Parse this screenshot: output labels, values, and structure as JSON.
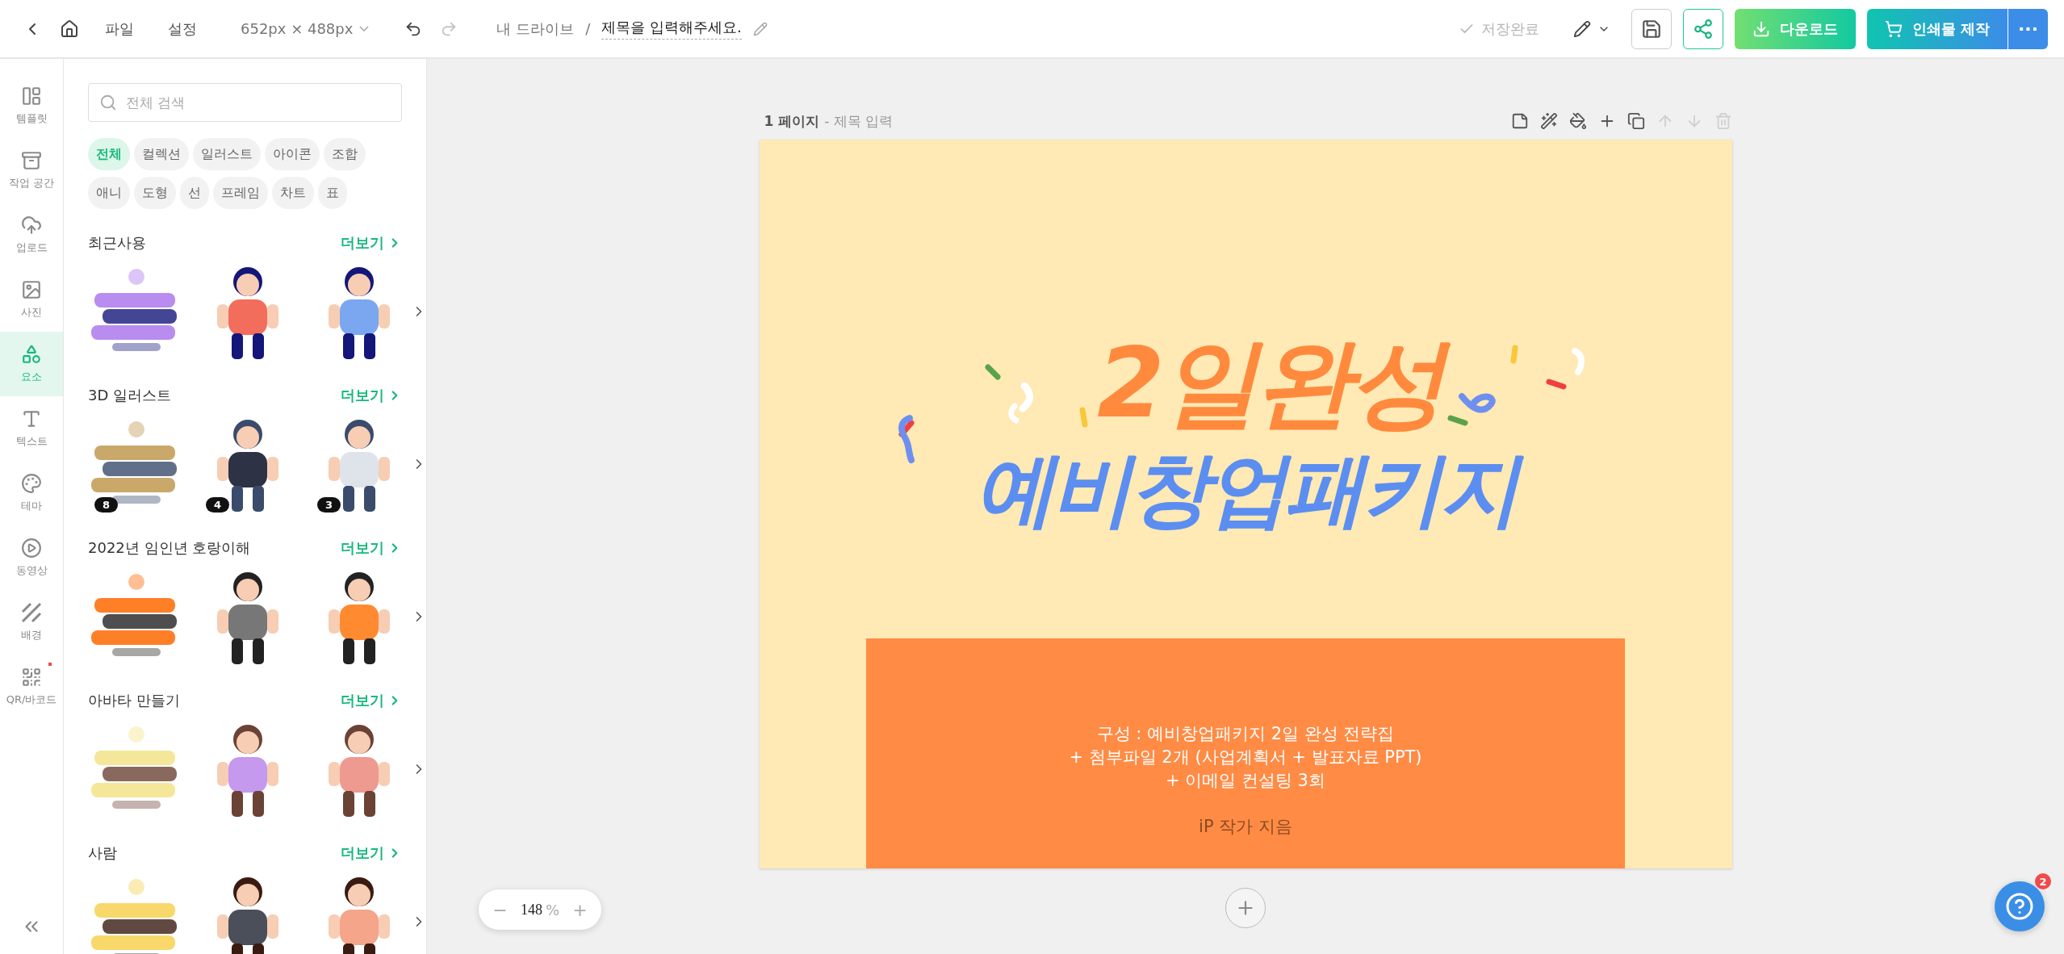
{
  "topbar": {
    "menu": [
      "파일",
      "설정"
    ],
    "size": "652px × 488px",
    "undo_disabled": false,
    "redo_disabled": true,
    "breadcrumb": "내 드라이브",
    "separator": "/",
    "title": "제목을 입력해주세요.",
    "save_status": "저장완료",
    "download": "다운로드",
    "print": "인쇄물 제작",
    "more": "···"
  },
  "rail": [
    {
      "kind": "template",
      "label": "템플릿",
      "selected": false
    },
    {
      "kind": "workspace",
      "label": "작업 공간",
      "selected": false
    },
    {
      "kind": "upload",
      "label": "업로드",
      "selected": false
    },
    {
      "label": "사진",
      "selected": false
    },
    {
      "kind": "elements",
      "label": "요소",
      "selected": true
    },
    {
      "kind": "text",
      "label": "텍스트",
      "selected": false
    },
    {
      "kind": "theme",
      "label": "테마",
      "selected": false
    },
    {
      "kind": "video",
      "label": "동영상",
      "selected": false
    },
    {
      "kind": "background",
      "label": "배경",
      "selected": false
    },
    {
      "kind": "qr",
      "label": "QR/바코드",
      "selected": false,
      "dot": true
    }
  ],
  "panel": {
    "search": {
      "placeholder": "전체 검색"
    },
    "chips": [
      {
        "label": "전체",
        "selected": true
      },
      {
        "label": "컬렉션",
        "selected": false
      },
      {
        "label": "일러스트",
        "selected": false
      },
      {
        "label": "아이콘",
        "selected": false
      },
      {
        "label": "조합",
        "selected": false
      },
      {
        "label": "애니",
        "selected": false
      },
      {
        "label": "도형",
        "selected": false
      },
      {
        "label": "선",
        "selected": false
      },
      {
        "label": "프레임",
        "selected": false
      },
      {
        "label": "차트",
        "selected": false
      },
      {
        "label": "표",
        "selected": false
      }
    ],
    "sections": [
      {
        "title": "최근사용",
        "more": "더보기"
      },
      {
        "title": "3D 일러스트",
        "more": "더보기",
        "items": [
          {
            "kind": "picture",
            "badge": "8"
          },
          {
            "kind": "picture",
            "badge": "4"
          },
          {
            "kind": "picture",
            "badge": "3"
          }
        ]
      },
      {
        "title": "2022년 임인년 호랑이해",
        "more": "더보기"
      },
      {
        "title": "아바타 만들기",
        "more": "더보기"
      },
      {
        "title": "사람",
        "more": "더보기"
      }
    ]
  },
  "page": {
    "number": "1 페이지",
    "title_placeholder": "- 제목 입력",
    "tools": [
      {
        "kind": "memo",
        "disabled": false
      },
      {
        "kind": "magic",
        "disabled": false
      },
      {
        "kind": "fill",
        "disabled": false
      },
      {
        "kind": "add",
        "disabled": false
      },
      {
        "kind": "copy",
        "disabled": false
      },
      {
        "kind": "up",
        "disabled": true
      },
      {
        "kind": "down",
        "disabled": true
      },
      {
        "kind": "delete",
        "disabled": true
      }
    ],
    "headline": "2일완성",
    "subhead": "예비창업패키지",
    "body": [
      "구성 : 예비창업패키지 2일 완성 전략집",
      "+ 첨부파일 2개 (사업계획서 + 발표자료 PPT)",
      "+ 이메일 컨설팅 3회"
    ],
    "author": "iP 작가 지음"
  },
  "zoom": {
    "minus": "−",
    "value": "148",
    "unit": "%",
    "plus": "+"
  },
  "help": {
    "badge": "2"
  }
}
